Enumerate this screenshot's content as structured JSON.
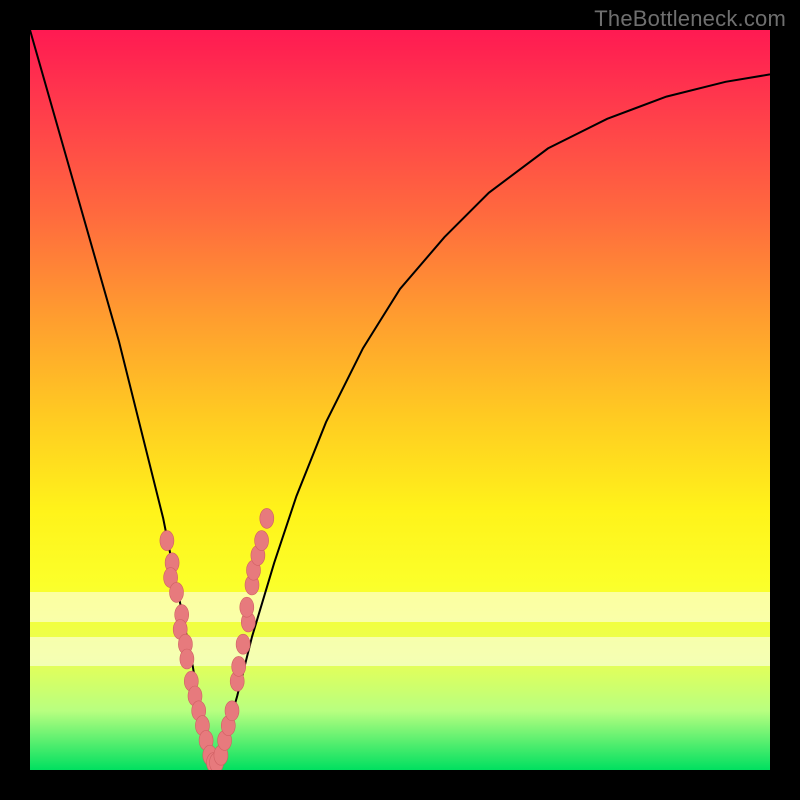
{
  "watermark": "TheBottleneck.com",
  "chart_data": {
    "type": "line",
    "title": "",
    "xlabel": "",
    "ylabel": "",
    "xlim": [
      0,
      100
    ],
    "ylim": [
      0,
      100
    ],
    "series": [
      {
        "name": "bottleneck-curve",
        "x": [
          0,
          4,
          8,
          12,
          15,
          18,
          20,
          22,
          23,
          24,
          25,
          26,
          28,
          30,
          33,
          36,
          40,
          45,
          50,
          56,
          62,
          70,
          78,
          86,
          94,
          100
        ],
        "y": [
          100,
          86,
          72,
          58,
          46,
          34,
          24,
          14,
          8,
          3,
          0,
          3,
          10,
          18,
          28,
          37,
          47,
          57,
          65,
          72,
          78,
          84,
          88,
          91,
          93,
          94
        ]
      }
    ],
    "scatter_points": {
      "name": "sample-dots",
      "x": [
        18.5,
        19.2,
        19.0,
        19.8,
        20.5,
        20.3,
        21.0,
        21.2,
        21.8,
        22.3,
        22.8,
        23.3,
        23.8,
        24.3,
        24.8,
        25.2,
        25.8,
        26.3,
        26.8,
        27.3,
        28.0,
        28.2,
        28.8,
        29.5,
        29.3,
        30.0,
        30.2,
        30.8,
        31.3,
        32.0
      ],
      "y": [
        31,
        28,
        26,
        24,
        21,
        19,
        17,
        15,
        12,
        10,
        8,
        6,
        4,
        2,
        1,
        1,
        2,
        4,
        6,
        8,
        12,
        14,
        17,
        20,
        22,
        25,
        27,
        29,
        31,
        34
      ]
    },
    "background_gradient_stops": [
      {
        "pos": 0.0,
        "color": "#ff1a52"
      },
      {
        "pos": 0.25,
        "color": "#ff6a3e"
      },
      {
        "pos": 0.52,
        "color": "#ffca22"
      },
      {
        "pos": 0.75,
        "color": "#fbff2a"
      },
      {
        "pos": 0.92,
        "color": "#b8ff80"
      },
      {
        "pos": 1.0,
        "color": "#00e060"
      }
    ],
    "highlight_bands_y": [
      {
        "from": 20,
        "to": 24
      },
      {
        "from": 14,
        "to": 18
      }
    ]
  }
}
